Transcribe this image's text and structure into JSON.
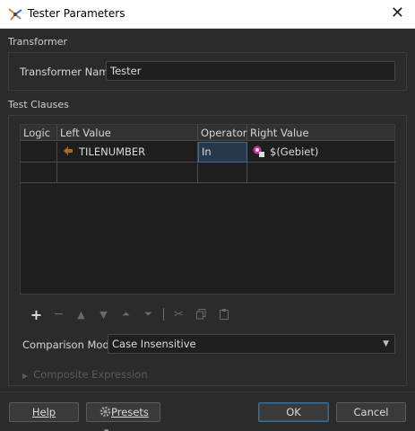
{
  "window": {
    "title": "Tester Parameters",
    "close_glyph": "✕"
  },
  "transformer": {
    "section_label": "Transformer",
    "name_label": "Transformer Name:",
    "name_value": "Tester"
  },
  "clauses": {
    "section_label": "Test Clauses",
    "columns": [
      "Logic",
      "Left Value",
      "Operator",
      "Right Value"
    ],
    "rows": [
      {
        "logic": "",
        "left": "TILENUMBER",
        "left_icon": "attribute-icon",
        "operator": "In",
        "right": "$(Gebiet)",
        "right_icon": "parameter-icon"
      },
      {
        "logic": "",
        "left": "",
        "operator": "",
        "right": ""
      }
    ]
  },
  "toolbar": {
    "icons": [
      "add-icon",
      "remove-icon",
      "move-up-icon",
      "move-down-icon",
      "move-top-icon",
      "move-bottom-icon",
      "cut-icon",
      "copy-icon",
      "paste-icon"
    ]
  },
  "comparison": {
    "label": "Comparison Mode:",
    "value": "Case Insensitive"
  },
  "composite": {
    "label": "Composite Expression"
  },
  "buttons": {
    "help": "Help",
    "presets": "Presets",
    "ok": "OK",
    "cancel": "Cancel"
  },
  "colors": {
    "accent": "#3f6c91",
    "background": "#2b2b2b",
    "selected_cell": "#26384a"
  }
}
